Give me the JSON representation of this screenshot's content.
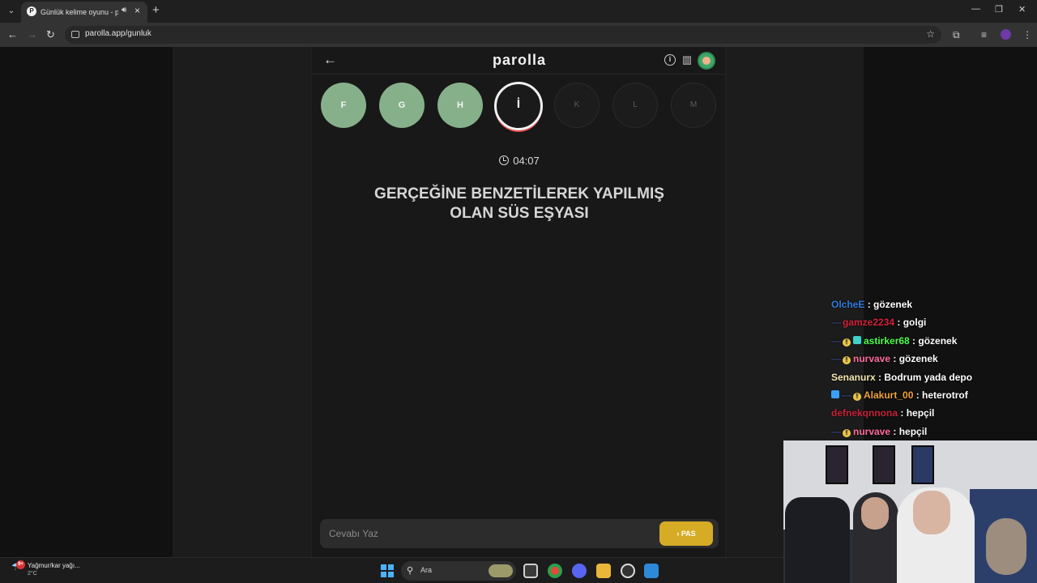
{
  "browser": {
    "tab_title": "Günlük kelime oyunu - parolla",
    "url": "parolla.app/gunluk"
  },
  "app": {
    "logo": "parolla",
    "letters": [
      {
        "char": "F",
        "state": "done"
      },
      {
        "char": "G",
        "state": "done"
      },
      {
        "char": "H",
        "state": "done"
      },
      {
        "char": "İ",
        "state": "active"
      },
      {
        "char": "K",
        "state": "todo"
      },
      {
        "char": "L",
        "state": "todo"
      },
      {
        "char": "M",
        "state": "todo"
      }
    ],
    "timer": "04:07",
    "question_line1": "GERÇEĞİNE BENZETİLEREK YAPILMIŞ",
    "question_line2": "OLAN SÜS EŞYASI",
    "answer_placeholder": "Cevabı Yaz",
    "pass_label": "PAS",
    "colors": {
      "done": "#86b08a",
      "pass": "#d6ab25",
      "active_ring": "#e44a4a"
    }
  },
  "chat": [
    {
      "user": "OlcheE",
      "color": "#2f7de1",
      "message": "gözenek",
      "badges": []
    },
    {
      "user": "gamze2234",
      "color": "#d6213a",
      "message": "golgi",
      "badges": [
        "dash"
      ]
    },
    {
      "user": "astirker68",
      "color": "#4cff4c",
      "message": "gözenek",
      "badges": [
        "dash",
        "coin",
        "square"
      ]
    },
    {
      "user": "nurvave",
      "color": "#ff6b9b",
      "message": "gözenek",
      "badges": [
        "dash",
        "coin"
      ]
    },
    {
      "user": "Senanurx",
      "color": "#f5e6b0",
      "message": "Bodrum yada depo",
      "badges": []
    },
    {
      "user": "Alakurt_00",
      "color": "#f2a23a",
      "message": "heterotrof",
      "badges": [
        "cube",
        "dash",
        "coin"
      ]
    },
    {
      "user": "defnekqnnona",
      "color": "#c8213a",
      "message": "hepçil",
      "badges": []
    },
    {
      "user": "nurvave",
      "color": "#ff6b9b",
      "message": "hepçil",
      "badges": [
        "dash",
        "coin"
      ]
    }
  ],
  "taskbar": {
    "weather_text": "Yağmur/kar yağı...",
    "weather_temp": "2°C",
    "weather_badge": "9+",
    "search_label": "Ara"
  }
}
